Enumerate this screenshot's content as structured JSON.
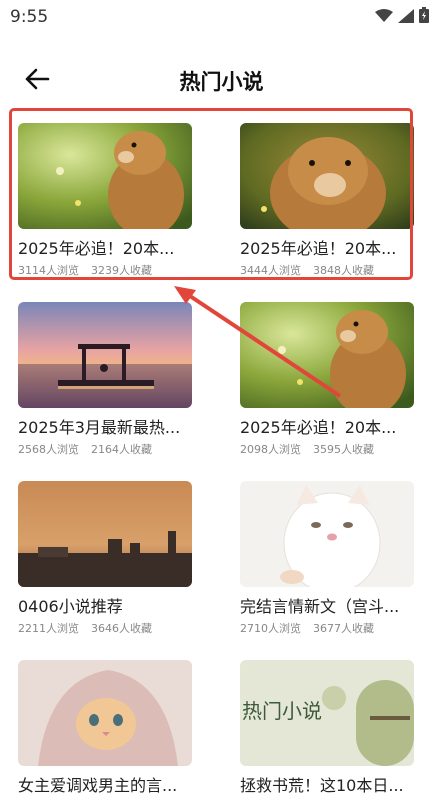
{
  "status_bar": {
    "time": "9:55"
  },
  "header": {
    "title": "热门小说"
  },
  "colors": {
    "highlight": "#e2453a"
  },
  "cards": [
    {
      "title": "2025年必追！20本...",
      "views": "3114人浏览",
      "saves": "3239人收藏",
      "image": "marmot-portrait"
    },
    {
      "title": "2025年必追！20本...",
      "views": "3444人浏览",
      "saves": "3848人收藏",
      "image": "marmot-closeup"
    },
    {
      "title": "2025年3月最新最热...",
      "views": "2568人浏览",
      "saves": "2164人收藏",
      "image": "sunset-pier"
    },
    {
      "title": "2025年必追！20本...",
      "views": "2098人浏览",
      "saves": "3595人收藏",
      "image": "marmot-portrait"
    },
    {
      "title": "0406小说推荐",
      "views": "2211人浏览",
      "saves": "3646人收藏",
      "image": "dust-storm-city"
    },
    {
      "title": "完结言情新文（宫斗...",
      "views": "2710人浏览",
      "saves": "3677人收藏",
      "image": "white-cat"
    },
    {
      "title": "女主爱调戏男主的言...",
      "views": "",
      "saves": "",
      "image": "cat-in-blanket"
    },
    {
      "title": "拯救书荒！这10本日...",
      "views": "",
      "saves": "",
      "image": "green-art-poster",
      "image_text": "热门小说"
    }
  ]
}
